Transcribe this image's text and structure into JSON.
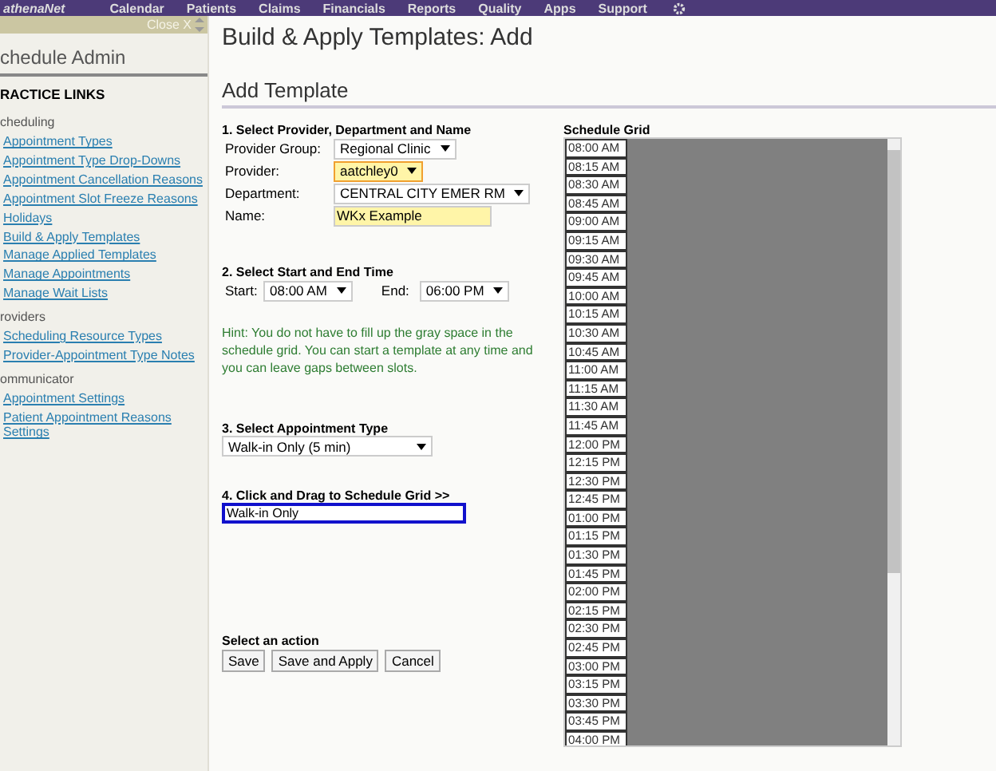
{
  "top_nav": {
    "logo": "athenaNet",
    "items": [
      "Calendar",
      "Patients",
      "Claims",
      "Financials",
      "Reports",
      "Quality",
      "Apps",
      "Support"
    ]
  },
  "sidebar": {
    "close_label": "Close X",
    "title": "chedule Admin",
    "heading": "RACTICE LINKS",
    "sections": [
      {
        "title": "cheduling",
        "links": [
          "Appointment Types",
          "Appointment Type Drop-Downs",
          "Appointment Cancellation Reasons",
          "Appointment Slot Freeze Reasons",
          "Holidays",
          "Build & Apply Templates",
          "Manage Applied Templates",
          "Manage Appointments",
          "Manage Wait Lists"
        ]
      },
      {
        "title": "roviders",
        "links": [
          "Scheduling Resource Types",
          "Provider-Appointment Type Notes"
        ]
      },
      {
        "title": "ommunicator",
        "links": [
          "Appointment Settings",
          "Patient Appointment Reasons Settings"
        ]
      }
    ]
  },
  "page": {
    "title": "Build & Apply Templates: Add",
    "section_title": "Add Template",
    "step1": {
      "heading": "1. Select Provider, Department and Name",
      "fields": [
        {
          "label": "Provider Group:",
          "value": "Regional Clinic",
          "kind": "select",
          "highlighted": false
        },
        {
          "label": "Provider:",
          "value": "aatchley0",
          "kind": "select",
          "highlighted": true
        },
        {
          "label": "Department:",
          "value": "CENTRAL CITY EMER RM",
          "kind": "select",
          "highlighted": false
        },
        {
          "label": "Name:",
          "value": "WKx Example",
          "kind": "text",
          "highlighted": true
        }
      ]
    },
    "step2": {
      "heading": "2. Select Start and End Time",
      "start_label": "Start:",
      "start_value": "08:00 AM",
      "end_label": "End:",
      "end_value": "06:00 PM"
    },
    "hint": "Hint: You do not have to fill up the gray space in the schedule grid. You can start a template at any time and you can leave gaps between slots.",
    "step3": {
      "heading": "3. Select Appointment Type",
      "value": "Walk-in Only (5 min)"
    },
    "step4": {
      "heading": "4. Click and Drag to Schedule Grid >>",
      "value": "Walk-in Only"
    },
    "actions": {
      "heading": "Select an action",
      "buttons": [
        "Save",
        "Save and Apply",
        "Cancel"
      ]
    }
  },
  "schedule_grid": {
    "title": "Schedule Grid",
    "slots": [
      "08:00 AM",
      "08:15 AM",
      "08:30 AM",
      "08:45 AM",
      "09:00 AM",
      "09:15 AM",
      "09:30 AM",
      "09:45 AM",
      "10:00 AM",
      "10:15 AM",
      "10:30 AM",
      "10:45 AM",
      "11:00 AM",
      "11:15 AM",
      "11:30 AM",
      "11:45 AM",
      "12:00 PM",
      "12:15 PM",
      "12:30 PM",
      "12:45 PM",
      "01:00 PM",
      "01:15 PM",
      "01:30 PM",
      "01:45 PM",
      "02:00 PM",
      "02:15 PM",
      "02:30 PM",
      "02:45 PM",
      "03:00 PM",
      "03:15 PM",
      "03:30 PM",
      "03:45 PM",
      "04:00 PM"
    ]
  }
}
